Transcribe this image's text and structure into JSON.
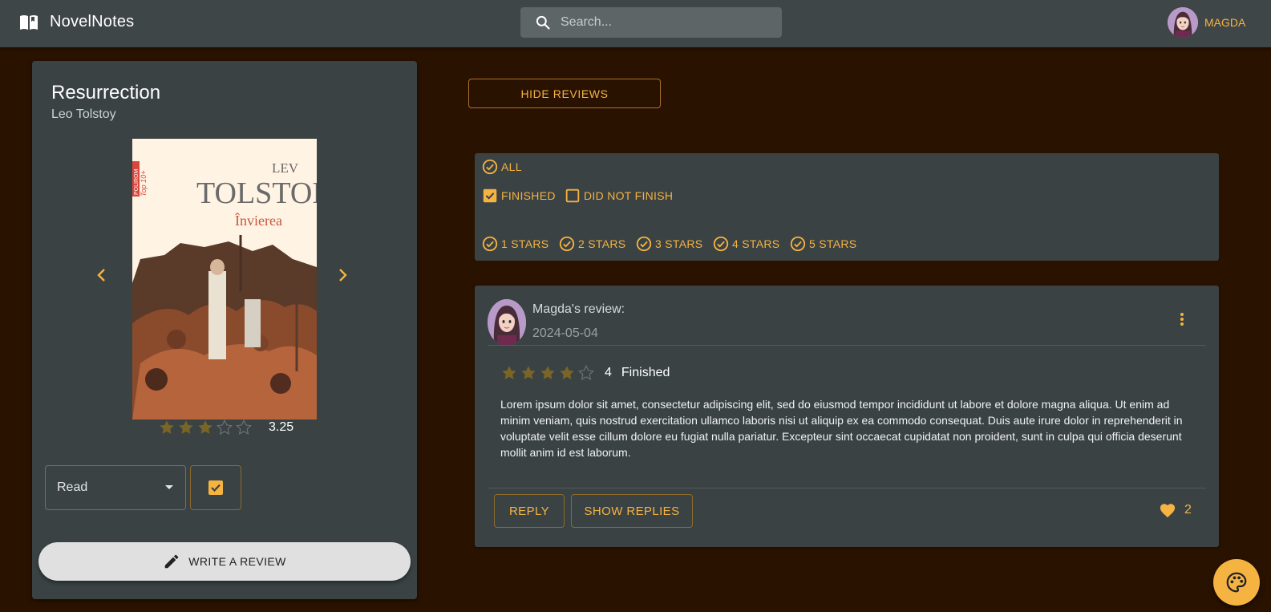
{
  "app": {
    "title": "NovelNotes"
  },
  "search": {
    "placeholder": "Search..."
  },
  "user": {
    "name": "MAGDA"
  },
  "book": {
    "title": "Resurrection",
    "author": "Leo Tolstoy",
    "cover": {
      "author_text": "LEV",
      "title_text": "TOLSTOI",
      "subtitle_text": "Învierea",
      "series_text": "POLIROM",
      "series_sub": "Top 10+"
    },
    "rating": 3.25,
    "rating_label": "3.25",
    "stars_filled": 3,
    "status": "Read",
    "write_review_label": "WRITE A REVIEW"
  },
  "hide_reviews_label": "HIDE REVIEWS",
  "filters": {
    "all_label": "ALL",
    "finished_label": "FINISHED",
    "finished_checked": true,
    "dnf_label": "DID NOT FINISH",
    "dnf_checked": false,
    "stars": [
      "1 STARS",
      "2 STARS",
      "3 STARS",
      "4 STARS",
      "5 STARS"
    ]
  },
  "review": {
    "author": "Magda's review:",
    "date": "2024-05-04",
    "stars_filled": 4,
    "score": "4",
    "status": "Finished",
    "text": "Lorem ipsum dolor sit amet, consectetur adipiscing elit, sed do eiusmod tempor incididunt ut labore et dolore magna aliqua. Ut enim ad minim veniam, quis nostrud exercitation ullamco laboris nisi ut aliquip ex ea commodo consequat. Duis aute irure dolor in reprehenderit in voluptate velit esse cillum dolore eu fugiat nulla pariatur. Excepteur sint occaecat cupidatat non proident, sunt in culpa qui officia deserunt mollit anim id est laborum.",
    "reply_label": "REPLY",
    "show_replies_label": "SHOW REPLIES",
    "likes": "2"
  },
  "colors": {
    "accent": "#f5b342",
    "background": "#2a1200",
    "card": "#3a4244",
    "appbar": "#3f4648",
    "star_filled": "#7a6526"
  },
  "icons": [
    "open-book-icon",
    "search-icon",
    "chevron-left-icon",
    "chevron-right-icon",
    "dropdown-arrow-icon",
    "checkbox-checked-icon",
    "pencil-icon",
    "check-circle-icon",
    "checkbox-empty-icon",
    "more-vert-icon",
    "heart-icon",
    "palette-icon"
  ]
}
